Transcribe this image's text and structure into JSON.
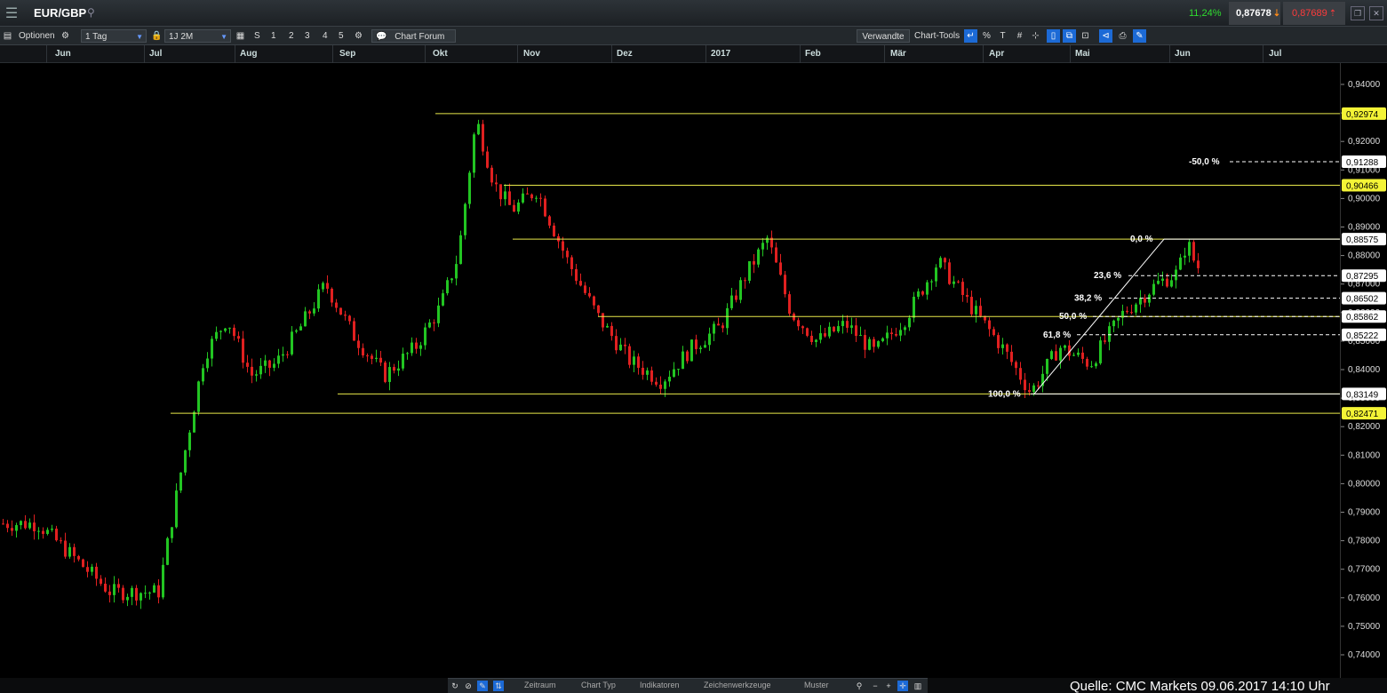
{
  "header": {
    "symbol": "EUR/GBP",
    "change_pct": "11,24%",
    "sell_price": "0,87678",
    "buy_price": "0,87689",
    "up_color": "#2fdc2f",
    "down_color": "#ff3b3b"
  },
  "toolbar": {
    "options_label": "Optionen",
    "interval_value": "1 Tag",
    "range_value": "1J 2M",
    "quick_ranges": [
      "S",
      "1",
      "2",
      "3",
      "4",
      "5"
    ],
    "chart_forum_label": "Chart Forum",
    "related_label": "Verwandte",
    "chart_tools_label": "Chart-Tools",
    "percent_label": "%"
  },
  "time_axis": {
    "months": [
      "Jun",
      "Jul",
      "Aug",
      "Sep",
      "Okt",
      "Nov",
      "Dez",
      "2017",
      "Feb",
      "Mär",
      "Apr",
      "Mai",
      "Jun",
      "Jul"
    ]
  },
  "price_scale": {
    "ticks": [
      "0,94000",
      "0,93000",
      "0,92000",
      "0,91000",
      "0,90000",
      "0,89000",
      "0,88000",
      "0,87000",
      "0,86000",
      "0,85000",
      "0,84000",
      "0,83000",
      "0,82000",
      "0,81000",
      "0,80000",
      "0,79000",
      "0,78000",
      "0,77000",
      "0,76000",
      "0,75000",
      "0,74000"
    ],
    "yellow_tags": [
      "0,92974",
      "0,90466",
      "0,82471"
    ],
    "white_tags": [
      "0,91288",
      "0,88575",
      "0,87295",
      "0,86502",
      "0,85862",
      "0,85222",
      "0,83149"
    ]
  },
  "chart_data": {
    "type": "candlestick",
    "symbol": "EUR/GBP",
    "interval": "1 Tag",
    "ylim": [
      0.735,
      0.945
    ],
    "horizontal_levels": [
      0.92974,
      0.90466,
      0.88575,
      0.85862,
      0.83149,
      0.82471
    ],
    "fibonacci": {
      "levels": [
        {
          "label": "-50,0 %",
          "value": 0.91288
        },
        {
          "label": "0,0 %",
          "value": 0.88575
        },
        {
          "label": "23,6 %",
          "value": 0.87295
        },
        {
          "label": "38,2 %",
          "value": 0.86502
        },
        {
          "label": "50,0 %",
          "value": 0.85862
        },
        {
          "label": "61,8 %",
          "value": 0.85222
        },
        {
          "label": "100,0 %",
          "value": 0.83149
        }
      ]
    },
    "price_path": [
      [
        "Jun",
        0.786
      ],
      [
        "Jun",
        0.762
      ],
      [
        "Jul",
        0.762
      ],
      [
        "Jul",
        0.805
      ],
      [
        "Jul",
        0.845
      ],
      [
        "Jul",
        0.858
      ],
      [
        "Aug",
        0.838
      ],
      [
        "Aug",
        0.842
      ],
      [
        "Aug",
        0.855
      ],
      [
        "Aug",
        0.87
      ],
      [
        "Sep",
        0.852
      ],
      [
        "Sep",
        0.838
      ],
      [
        "Sep",
        0.848
      ],
      [
        "Okt",
        0.862
      ],
      [
        "Okt",
        0.88
      ],
      [
        "Okt",
        0.928
      ],
      [
        "Okt",
        0.905
      ],
      [
        "Okt",
        0.896
      ],
      [
        "Nov",
        0.903
      ],
      [
        "Nov",
        0.878
      ],
      [
        "Nov",
        0.858
      ],
      [
        "Dez",
        0.843
      ],
      [
        "Dez",
        0.836
      ],
      [
        "Dez",
        0.848
      ],
      [
        "2017",
        0.855
      ],
      [
        "2017",
        0.872
      ],
      [
        "2017",
        0.886
      ],
      [
        "2017",
        0.86
      ],
      [
        "Feb",
        0.85
      ],
      [
        "Feb",
        0.856
      ],
      [
        "Feb",
        0.846
      ],
      [
        "Mär",
        0.858
      ],
      [
        "Mär",
        0.878
      ],
      [
        "Mär",
        0.862
      ],
      [
        "Apr",
        0.848
      ],
      [
        "Apr",
        0.832
      ],
      [
        "Apr",
        0.848
      ],
      [
        "Mai",
        0.842
      ],
      [
        "Mai",
        0.86
      ],
      [
        "Mai",
        0.87
      ],
      [
        "Jun",
        0.874
      ],
      [
        "Jun",
        0.885
      ],
      [
        "Jun",
        0.876
      ]
    ]
  },
  "bottom_bar": {
    "tabs": [
      "Zeitraum",
      "Chart Typ",
      "Indikatoren",
      "Zeichenwerkzeuge",
      "Muster"
    ],
    "source": "Quelle: CMC Markets 09.06.2017 14:10 Uhr"
  }
}
